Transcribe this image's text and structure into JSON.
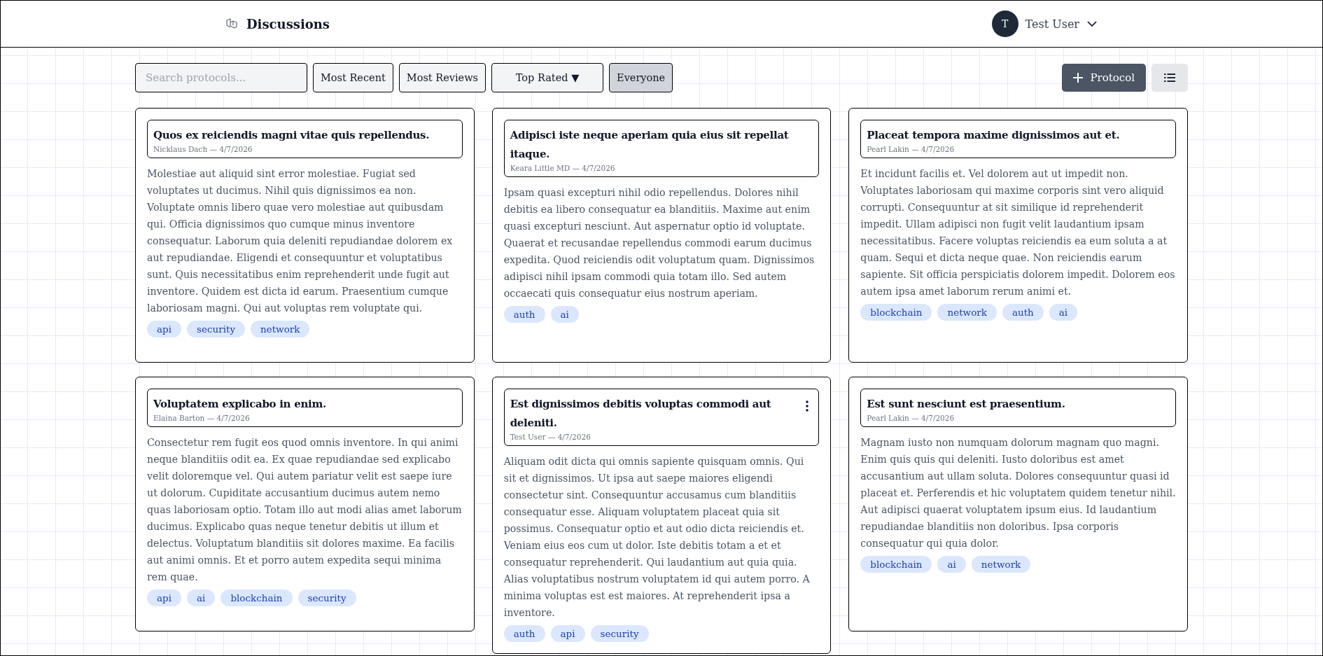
{
  "header": {
    "title": "Discussions",
    "user": {
      "initial": "T",
      "name": "Test User"
    }
  },
  "toolbar": {
    "search": {
      "placeholder": "Search protocols..."
    },
    "filters": [
      {
        "label": "Most Recent",
        "selected": false
      },
      {
        "label": "Most Reviews",
        "selected": false
      },
      {
        "label": "Top Rated",
        "caret": "▼",
        "selected": false
      },
      {
        "label": "Everyone",
        "selected": true
      }
    ],
    "new_button": {
      "label": "Protocol"
    }
  },
  "posts": [
    {
      "title": "Quos ex reiciendis magni vitae quis repellendus.",
      "meta": "Nicklaus Dach — 4/7/2026",
      "has_menu": false,
      "body": "Molestiae aut aliquid sint error molestiae. Fugiat sed voluptates ut ducimus. Nihil quis dignissimos ea non. Voluptate omnis libero quae vero molestiae aut quibusdam qui. Officia dignissimos quo cumque minus inventore consequatur. Laborum quia deleniti repudiandae dolorem ex aut repudiandae. Eligendi et consequuntur et voluptatibus sunt. Quis necessitatibus enim reprehenderit unde fugit aut inventore. Quidem est dicta id earum. Praesentium cumque laboriosam magni. Qui aut voluptas rem voluptate qui.",
      "tags": [
        "api",
        "security",
        "network"
      ]
    },
    {
      "title": "Adipisci iste neque aperiam quia eius sit repellat itaque.",
      "meta": "Keara Little MD — 4/7/2026",
      "has_menu": false,
      "body": "Ipsam quasi excepturi nihil odio repellendus. Dolores nihil debitis ea libero consequatur ea blanditiis. Maxime aut enim quasi excepturi nesciunt. Aut aspernatur optio id voluptate. Quaerat et recusandae repellendus commodi earum ducimus expedita. Quod reiciendis odit voluptatum quam. Dignissimos adipisci nihil ipsam commodi quia totam illo. Sed autem occaecati quis consequatur eius nostrum aperiam.",
      "tags": [
        "auth",
        "ai"
      ]
    },
    {
      "title": "Placeat tempora maxime dignissimos aut et.",
      "meta": "Pearl Lakin — 4/7/2026",
      "has_menu": false,
      "body": "Et incidunt facilis et. Vel dolorem aut ut impedit non. Voluptates laboriosam qui maxime corporis sint vero aliquid corrupti. Consequuntur at sit similique id reprehenderit impedit. Ullam adipisci non fugit velit laudantium ipsam necessitatibus. Facere voluptas reiciendis ea eum soluta a at quam. Sequi et dicta neque quae. Non reiciendis earum sapiente. Sit officia perspiciatis dolorem impedit. Dolorem eos autem ipsa amet laborum rerum animi et.",
      "tags": [
        "blockchain",
        "network",
        "auth",
        "ai"
      ]
    },
    {
      "title": "Voluptatem explicabo in enim.",
      "meta": "Elaina Barton — 4/7/2026",
      "has_menu": false,
      "body": "Consectetur rem fugit eos quod omnis inventore. In qui animi neque blanditiis odit ea. Ex quae repudiandae sed explicabo velit doloremque vel. Qui autem pariatur velit est saepe iure ut dolorum. Cupiditate accusantium ducimus autem nemo quas laboriosam optio. Totam illo aut modi alias amet laborum ducimus. Explicabo quas neque tenetur debitis ut illum et delectus. Voluptatum blanditiis sit dolores maxime. Ea facilis aut animi omnis. Et et porro autem expedita sequi minima rem quae.",
      "tags": [
        "api",
        "ai",
        "blockchain",
        "security"
      ]
    },
    {
      "title": "Est dignissimos debitis voluptas commodi aut deleniti.",
      "meta": "Test User — 4/7/2026",
      "has_menu": true,
      "body": "Aliquam odit dicta qui omnis sapiente quisquam omnis. Qui sit et dignissimos. Ut ipsa aut saepe maiores eligendi consectetur sint. Consequuntur accusamus cum blanditiis consequatur esse. Aliquam voluptatem placeat quia sit possimus. Consequatur optio et aut odio dicta reiciendis et. Veniam eius eos cum ut dolor. Iste debitis totam a et et consequatur reprehenderit. Qui laudantium aut quia quia. Alias voluptatibus nostrum voluptatem id qui autem porro. A minima voluptas est est maiores. At reprehenderit ipsa a inventore.",
      "tags": [
        "auth",
        "api",
        "security"
      ]
    },
    {
      "title": "Est sunt nesciunt est praesentium.",
      "meta": "Pearl Lakin — 4/7/2026",
      "has_menu": false,
      "body": "Magnam iusto non numquam dolorum magnam quo magni. Enim quis quis qui deleniti. Iusto doloribus est amet accusantium aut ullam soluta. Dolores consequuntur quasi id placeat et. Perferendis et hic voluptatem quidem tenetur nihil. Aut adipisci quaerat voluptatem ipsum eius. Id laudantium repudiandae blanditiis non doloribus. Ipsa corporis consequatur qui quia dolor.",
      "tags": [
        "blockchain",
        "ai",
        "network"
      ]
    }
  ]
}
